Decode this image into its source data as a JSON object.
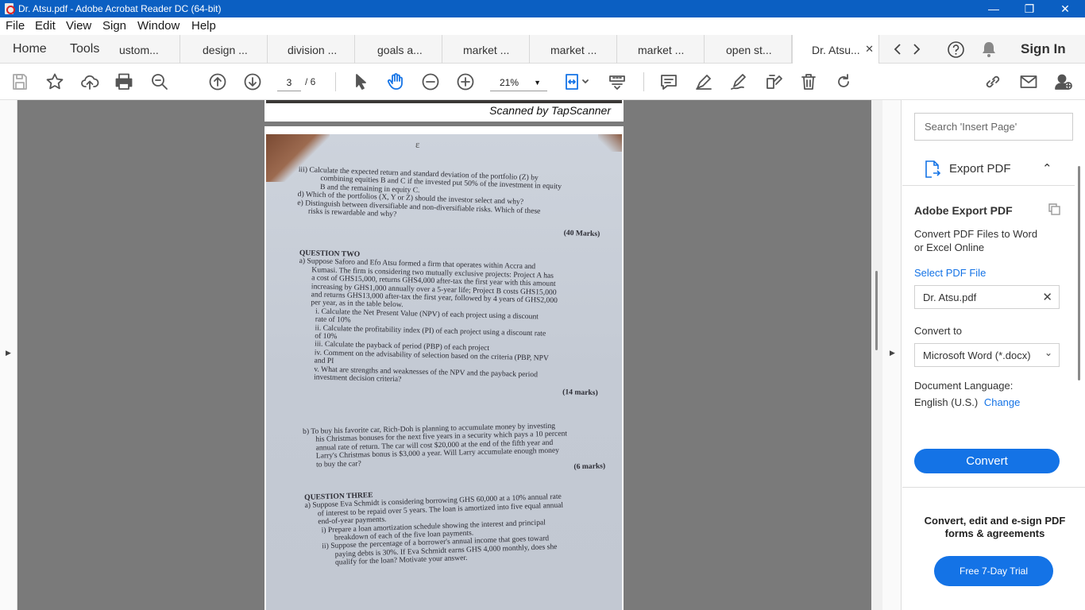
{
  "window": {
    "title": "Dr. Atsu.pdf - Adobe Acrobat Reader DC (64-bit)",
    "minimize": "—",
    "restore": "❐",
    "close": "✕"
  },
  "menu": [
    "File",
    "Edit",
    "View",
    "Sign",
    "Window",
    "Help"
  ],
  "tabs": {
    "home": "Home",
    "tools": "Tools",
    "docs": [
      "ustom...",
      "design ...",
      "division ...",
      "goals a...",
      "market ...",
      "market ...",
      "market ...",
      "open st...",
      "Dr. Atsu..."
    ],
    "active_close": "✕",
    "sign_in": "Sign In"
  },
  "toolbar": {
    "page_current": "3",
    "page_total": "/ 6",
    "zoom": "21%"
  },
  "page_caption": "Scanned by TapScanner",
  "scan": {
    "page_mark": "ε",
    "q1_lines": [
      "iii) Calculate the expected return and standard deviation of the portfolio (Z) by",
      "combining equities B and C if the invested put 50% of the investment in equity",
      "B and the remaining in equity C.",
      "d) Which of the portfolios (X, Y or Z) should the investor select and why?",
      "e) Distinguish between diversifiable and non-diversifiable risks. Which of these",
      "risks is rewardable and why?"
    ],
    "q1_marks": "(40 Marks)",
    "q2_title": "QUESTION TWO",
    "q2a_lines": [
      "a) Suppose Saforo and Efo Atsu formed  a firm that operates within Accra and",
      "Kumasi. The firm is considering  two mutually exclusive projects: Project A has",
      "a cost of GHS15,000, returns GHS4,000 after-tax the first year with this amount",
      "increasing by GHS1,000 annually over a 5-year life; Project B costs GHS15,000",
      "and returns GHS13,000 after-tax the first year, followed by 4 years of GHS2,000",
      "per year, as in the table below."
    ],
    "q2a_items": [
      "i.    Calculate the Net Present Value (NPV) of each project using a discount",
      "       rate of 10%",
      "ii.    Calculate the profitability index (PI) of each project using a discount rate",
      "       of 10%",
      "iii.   Calculate the payback of period (PBP) of each project",
      "iv.   Comment on the advisability of selection based on the criteria (PBP, NPV",
      "       and PI",
      "v.    What are strengths and weaknesses of the NPV and the payback period",
      "       investment decision criteria?"
    ],
    "q2a_marks": "(14 marks)",
    "q2b_lines": [
      "b) To buy his favorite car, Rich-Doh is planning to accumulate money by investing",
      "his Christmas bonuses for the next five years in a security which pays a 10 percent",
      "annual rate of return. The car will cost $20,000 at the end of the fifth year and",
      "Larry's Christmas bonus is $3,000 a year. Will Larry accumulate enough money",
      "to buy the car?"
    ],
    "q2b_marks": "(6 marks)",
    "q3_title": "QUESTION THREE",
    "q3a_lines": [
      "a) Suppose Eva Schmidt is considering borrowing GHS 60,000 at a 10% annual rate",
      "of interest to be repaid over 5 years. The loan is amortized into five equal annual",
      "end-of-year payments.",
      "i) Prepare a loan amortization schedule showing the interest and principal",
      "breakdown of each of the five loan payments.",
      "ii) Suppose the percentage of a borrower's annual income that goes toward",
      "paying debts is 30%. If Eva Schmidt earns GHS 4,000 monthly, does she",
      "qualify for the loan? Motivate your answer."
    ]
  },
  "right_panel": {
    "search_placeholder": "Search 'Insert Page'",
    "export_label": "Export PDF",
    "adobe_export_title": "Adobe Export PDF",
    "adobe_export_desc": "Convert PDF Files to Word or Excel Online",
    "select_file_link": "Select PDF File",
    "file_name": "Dr. Atsu.pdf",
    "convert_to_label": "Convert to",
    "convert_to_value": "Microsoft Word (*.docx)",
    "doc_lang_label": "Document Language:",
    "doc_lang_value": "English (U.S.)",
    "change_link": "Change",
    "convert_button": "Convert",
    "promo_text": "Convert, edit and e-sign PDF forms & agreements",
    "trial_button": "Free 7-Day Trial"
  },
  "colors": {
    "titlebar": "#0b5fc2",
    "accent": "#1473e6",
    "canvas": "#7a7a7a"
  }
}
